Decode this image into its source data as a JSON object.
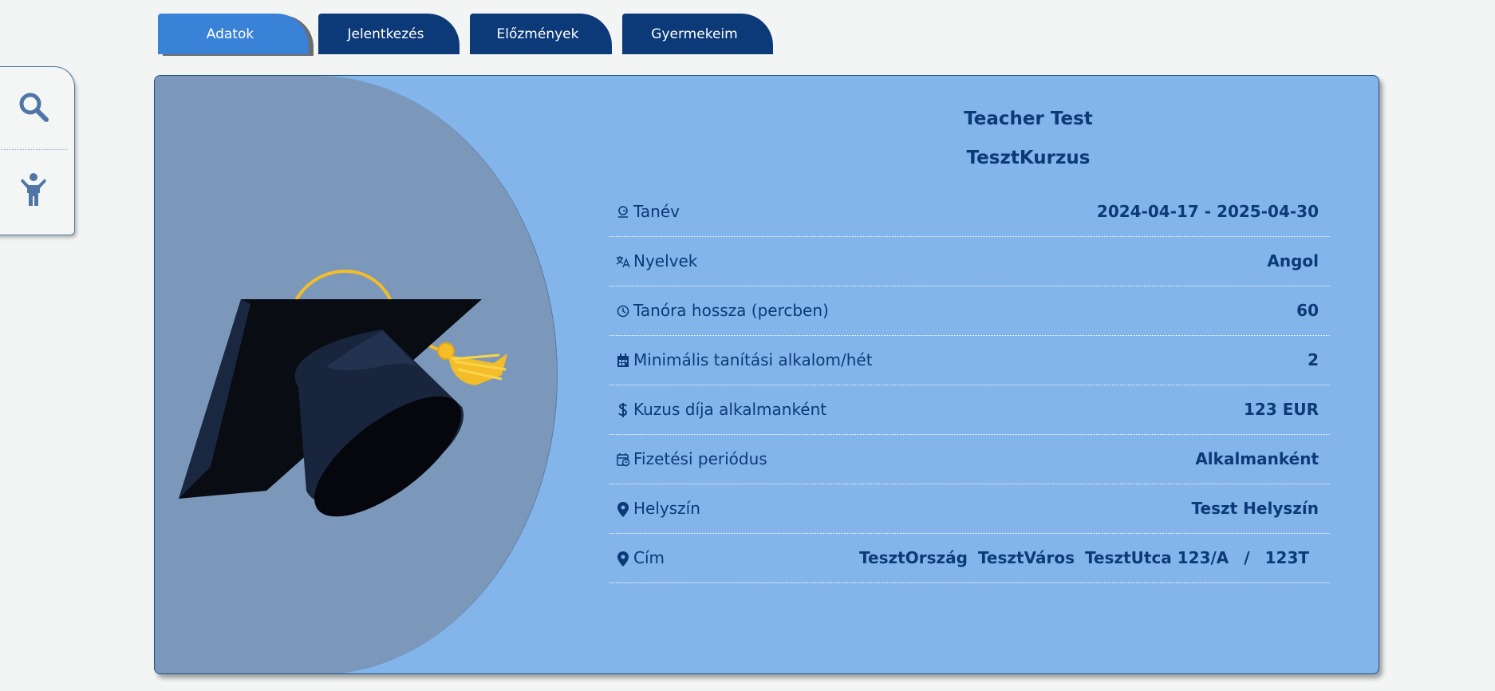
{
  "sidebar": {
    "icons": [
      "search-icon",
      "child-icon"
    ]
  },
  "tabs": [
    {
      "label": "Adatok",
      "active": true
    },
    {
      "label": "Jelentkezés",
      "active": false
    },
    {
      "label": "Előzmények",
      "active": false
    },
    {
      "label": "Gyermekeim",
      "active": false
    }
  ],
  "course": {
    "teacher": "Teacher Test",
    "name": "TesztKurzus",
    "rows": [
      {
        "icon": "school-year-icon",
        "label": "Tanév",
        "value": "2024-04-17 - 2025-04-30"
      },
      {
        "icon": "translate-icon",
        "label": "Nyelvek",
        "value": "Angol"
      },
      {
        "icon": "clock-icon",
        "label": "Tanóra hossza (percben)",
        "value": "60"
      },
      {
        "icon": "calendar-icon",
        "label": "Minimális tanítási alkalom/hét",
        "value": "2"
      },
      {
        "icon": "dollar-icon",
        "label": "Kuzus díja alkalmanként",
        "value": "123 EUR"
      },
      {
        "icon": "calendar-clock-icon",
        "label": "Fizetési periódus",
        "value": "Alkalmanként"
      },
      {
        "icon": "location-pin-icon",
        "label": "Helyszín",
        "value": "Teszt Helyszín"
      }
    ],
    "address": {
      "icon": "location-pin-icon",
      "label": "Cím",
      "country": "TesztOrszág",
      "city": "TesztVáros",
      "street": "TesztUtca 123/A",
      "separator": "/",
      "extra": "123T"
    }
  },
  "colors": {
    "accent": "#3a82d8",
    "tab_dark": "#0c3a78",
    "card_bg": "#83b4ea",
    "image_bg": "#7b98bb",
    "text": "#0c3a78"
  }
}
